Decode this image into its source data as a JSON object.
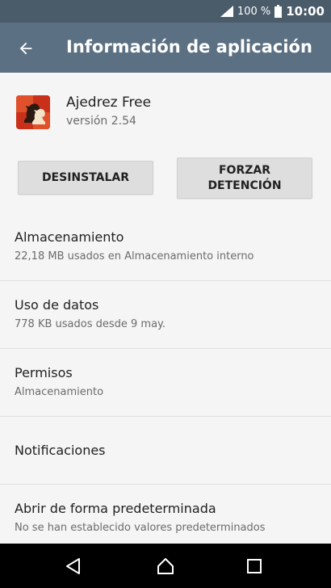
{
  "status_bar": {
    "battery_percent": "100 %",
    "time": "10:00",
    "icons": [
      "signal-icon",
      "battery-icon"
    ]
  },
  "app_bar": {
    "title": "Información de aplicación",
    "back_icon": "arrow-back-icon"
  },
  "app": {
    "name": "Ajedrez Free",
    "version": "versión 2.54",
    "icon": "chess-knight-icon"
  },
  "buttons": {
    "uninstall": "DESINSTALAR",
    "force_stop": "FORZAR DETENCIÓN"
  },
  "settings": [
    {
      "title": "Almacenamiento",
      "subtitle": "22,18 MB usados en Almacenamiento interno"
    },
    {
      "title": "Uso de datos",
      "subtitle": "778 KB usados desde 9 may."
    },
    {
      "title": "Permisos",
      "subtitle": "Almacenamiento"
    },
    {
      "title": "Notificaciones",
      "subtitle": ""
    },
    {
      "title": "Abrir de forma predeterminada",
      "subtitle": "No se han establecido valores predeterminados"
    }
  ],
  "nav_bar": {
    "icons": [
      "nav-back-icon",
      "nav-home-icon",
      "nav-recents-icon"
    ]
  },
  "colors": {
    "status_bar": "#4a5b6a",
    "app_bar": "#5b7082",
    "background": "#f5f5f5",
    "button": "#dedede",
    "nav_bar": "#000000"
  }
}
